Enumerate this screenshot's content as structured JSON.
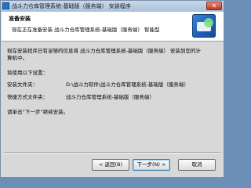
{
  "window": {
    "title": "战斗力仓库管理系统-基础版（服务端） 安装程序",
    "close_symbol": "✕"
  },
  "header": {
    "title": "准备安装",
    "subtitle": "现在正在准备安装 战斗力仓库管理系统-基础版（服务端） 智能型"
  },
  "body": {
    "intro_line1": "现在安装程序已有足够的信息将 战斗力仓库管理系统-基础版（服务端） 安装到您的计",
    "intro_line2": "算机中。",
    "settings_heading": "将使用以下设置：",
    "install_folder_label": "安装文件夹：",
    "install_folder_value": "D:\\战斗力软件\\战斗力仓库管理系统-基础版（服务端）",
    "shortcut_folder_label": "快捷方式文件夹：",
    "shortcut_folder_value": "战斗力仓库管理系统-基础版（服务端）",
    "instruction": "请单击“下一步”继续安装。"
  },
  "buttons": {
    "back": "< 返回(B)",
    "next": "下一步(N) >",
    "cancel": "取消"
  },
  "colors": {
    "title_bar": "#b8cce2",
    "header_bg": "#ffffff",
    "dialog_bg": "#d8d8d8",
    "default_button_border": "#3c7fb1"
  }
}
